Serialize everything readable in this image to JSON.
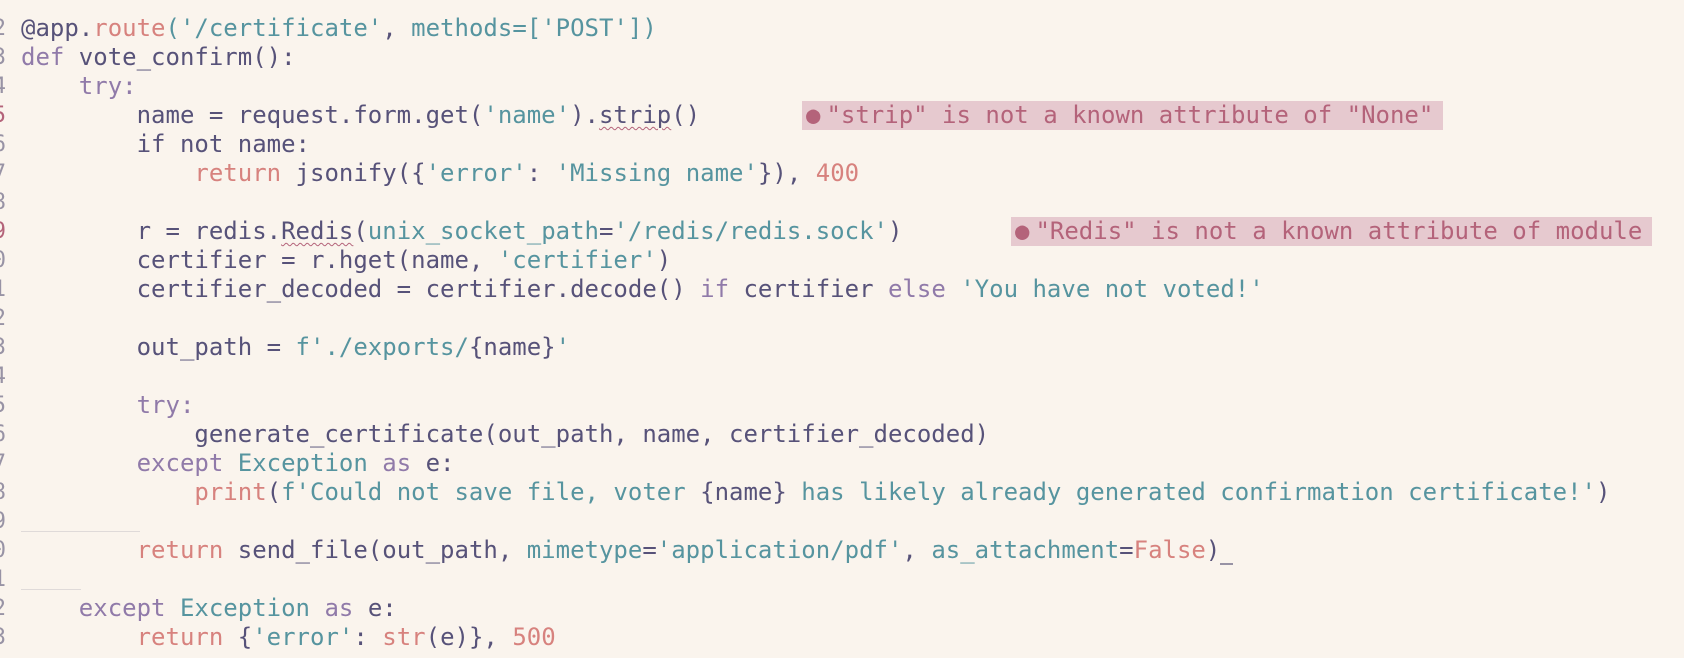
{
  "editor": {
    "lines": [
      {
        "num": "2",
        "error": false,
        "tokens": [
          [
            "@app.",
            "plain"
          ],
          [
            "route",
            "fn"
          ],
          [
            "('/certificate'",
            "str"
          ],
          [
            ", ",
            "plain"
          ],
          [
            "methods",
            "param"
          ],
          [
            "=['POST'])",
            "str"
          ]
        ]
      },
      {
        "num": "3",
        "error": false,
        "tokens": [
          [
            "def ",
            "kw"
          ],
          [
            "vote_confirm",
            "plain"
          ],
          [
            "():",
            "plain"
          ]
        ]
      },
      {
        "num": "4",
        "error": false,
        "tokens": [
          [
            "    try:",
            "kw"
          ]
        ]
      },
      {
        "num": "5",
        "error": true,
        "tokens": [
          [
            "        name = request.form.get(",
            "plain"
          ],
          [
            "'name'",
            "str"
          ],
          [
            ").",
            "plain"
          ],
          [
            "strip",
            "plain-err"
          ],
          [
            "()",
            "plain"
          ]
        ]
      },
      {
        "num": "6",
        "error": false,
        "tokens": [
          [
            "        if not ",
            "plain"
          ],
          [
            "name:",
            "plain"
          ]
        ]
      },
      {
        "num": "7",
        "error": false,
        "tokens": [
          [
            "            return ",
            "fn"
          ],
          [
            "jsonify({",
            "plain"
          ],
          [
            "'error'",
            "str"
          ],
          [
            ": ",
            "plain"
          ],
          [
            "'Missing name'",
            "str"
          ],
          [
            "}), ",
            "plain"
          ],
          [
            "400",
            "num"
          ]
        ]
      },
      {
        "num": "8",
        "error": false,
        "tokens": []
      },
      {
        "num": "9",
        "error": true,
        "tokens": [
          [
            "        r = redis.",
            "plain"
          ],
          [
            "Redis",
            "plain-err"
          ],
          [
            "(",
            "plain"
          ],
          [
            "unix_socket_path",
            "param"
          ],
          [
            "=",
            "plain"
          ],
          [
            "'/redis/redis.sock'",
            "str"
          ],
          [
            ")",
            "plain"
          ]
        ]
      },
      {
        "num": "0",
        "error": false,
        "tokens": [
          [
            "        certifier = r.hget(name, ",
            "plain"
          ],
          [
            "'certifier'",
            "str"
          ],
          [
            ")",
            "plain"
          ]
        ]
      },
      {
        "num": "1",
        "error": false,
        "tokens": [
          [
            "        certifier_decoded = certifier.decode() ",
            "plain"
          ],
          [
            "if ",
            "kw"
          ],
          [
            "certifier ",
            "plain"
          ],
          [
            "else ",
            "kw"
          ],
          [
            "'You have not voted!'",
            "str"
          ]
        ]
      },
      {
        "num": "2",
        "error": false,
        "tokens": []
      },
      {
        "num": "3",
        "error": false,
        "tokens": [
          [
            "        out_path = ",
            "plain"
          ],
          [
            "f'./exports/",
            "str"
          ],
          [
            "{name}",
            "plain"
          ],
          [
            "'",
            "str"
          ]
        ]
      },
      {
        "num": "4",
        "error": false,
        "tokens": []
      },
      {
        "num": "5",
        "error": false,
        "tokens": [
          [
            "        try:",
            "kw"
          ]
        ]
      },
      {
        "num": "6",
        "error": false,
        "tokens": [
          [
            "            generate_certificate(out_path, name, certifier_decoded)",
            "plain"
          ]
        ]
      },
      {
        "num": "7",
        "error": false,
        "tokens": [
          [
            "        except ",
            "kw"
          ],
          [
            "Exception ",
            "type"
          ],
          [
            "as ",
            "kw"
          ],
          [
            "e:",
            "plain"
          ]
        ]
      },
      {
        "num": "8",
        "error": false,
        "tokens": [
          [
            "            print",
            "fn"
          ],
          [
            "(",
            "plain"
          ],
          [
            "f'Could not save file, voter ",
            "str"
          ],
          [
            "{name}",
            "plain"
          ],
          [
            " has likely already generated confirmation certificate!'",
            "str"
          ],
          [
            ")",
            "plain"
          ]
        ]
      },
      {
        "num": "9",
        "error": false,
        "tokens": []
      },
      {
        "num": "0",
        "error": false,
        "tokens": [
          [
            "        return ",
            "fn"
          ],
          [
            "send_file(out_path, ",
            "plain"
          ],
          [
            "mimetype",
            "param"
          ],
          [
            "=",
            "plain"
          ],
          [
            "'application/pdf'",
            "str"
          ],
          [
            ", ",
            "plain"
          ],
          [
            "as_attachment",
            "param"
          ],
          [
            "=",
            "plain"
          ],
          [
            "False",
            "bool"
          ],
          [
            ")",
            "plain"
          ]
        ]
      },
      {
        "num": "1",
        "error": false,
        "tokens": []
      },
      {
        "num": "2",
        "error": false,
        "tokens": [
          [
            "    except ",
            "kw"
          ],
          [
            "Exception ",
            "type"
          ],
          [
            "as ",
            "kw"
          ],
          [
            "e:",
            "plain"
          ]
        ]
      },
      {
        "num": "3",
        "error": false,
        "tokens": [
          [
            "        return ",
            "fn"
          ],
          [
            "{",
            "plain"
          ],
          [
            "'error'",
            "str"
          ],
          [
            ": ",
            "plain"
          ],
          [
            "str",
            "fn"
          ],
          [
            "(e)}, ",
            "plain"
          ],
          [
            "500",
            "num"
          ]
        ]
      }
    ],
    "diagnostics": [
      {
        "line": 3,
        "text": "\"strip\" is not a known attribute of \"None\""
      },
      {
        "line": 7,
        "text": "\"Redis\" is not a known attribute of module"
      }
    ],
    "colors": {
      "background": "#faf4ed",
      "error": "#b4637a",
      "error_bg": "#e6c9cf"
    }
  }
}
